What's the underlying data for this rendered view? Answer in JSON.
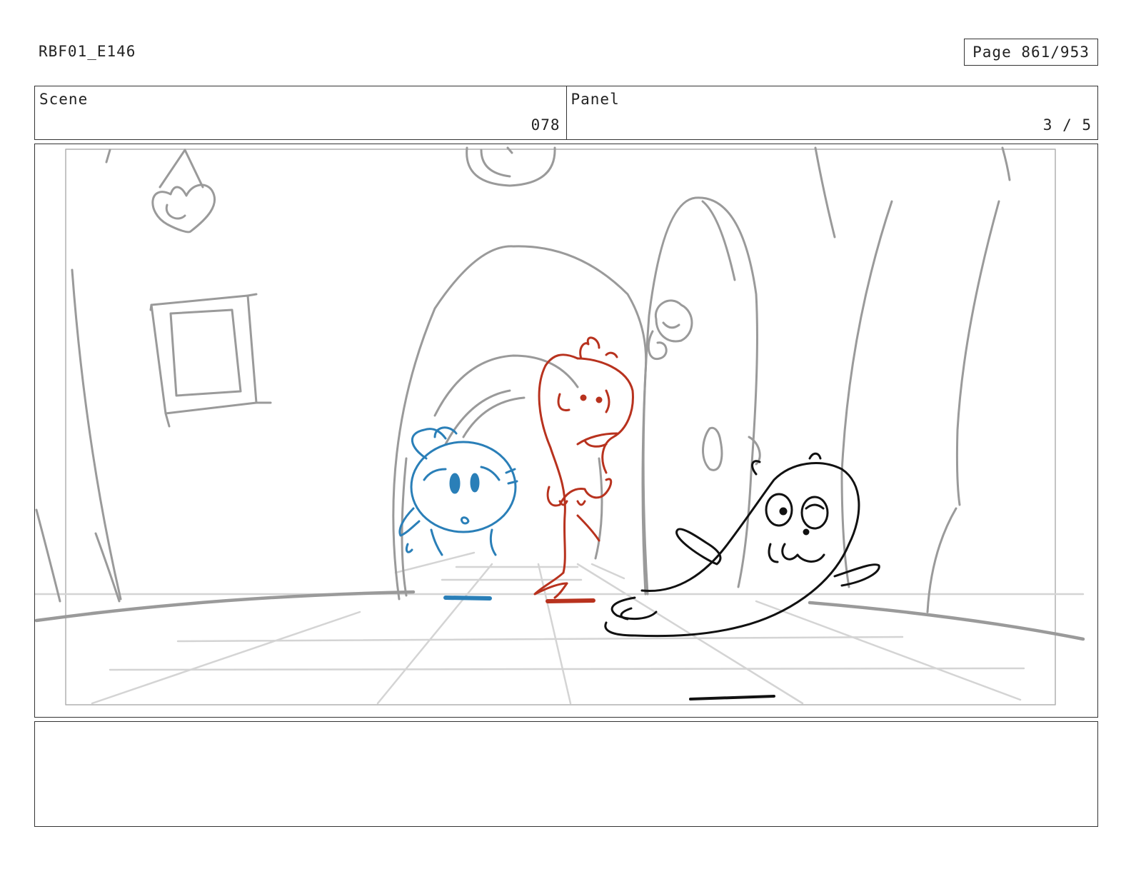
{
  "header": {
    "doc_id": "RBF01_E146",
    "page_label": "Page 861/953"
  },
  "info": {
    "scene_label": "Scene",
    "scene_value": "078",
    "panel_label": "Panel",
    "panel_value": "3 / 5"
  },
  "drawing": {
    "stroke_colors": {
      "background": "#9a9a9a",
      "floor": "#d4d4d4",
      "blue_character": "#2a7fb8",
      "red_character": "#b8321e",
      "black_character": "#111111"
    }
  },
  "notes": {
    "text": ""
  }
}
